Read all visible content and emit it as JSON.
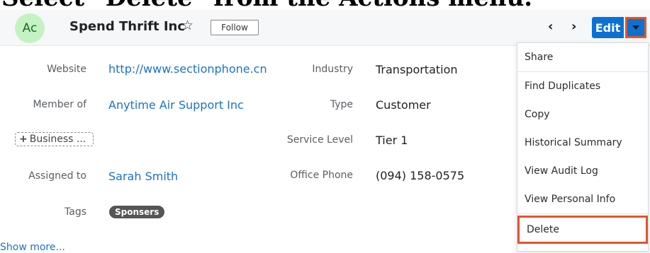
{
  "instruction": "Select \"Delete\" from the Actions menu.",
  "header": {
    "avatar_initials": "Ac",
    "record_name": "Spend Thrift Inc",
    "follow_label": "Follow",
    "edit_label": "Edit",
    "icons": [
      "star-icon",
      "chevron-left-icon",
      "chevron-right-icon",
      "caret-down-icon"
    ]
  },
  "fields": {
    "website": {
      "label": "Website",
      "value": "http://www.sectionphone.cn"
    },
    "member_of": {
      "label": "Member of",
      "value": "Anytime Air Support Inc"
    },
    "business_add": "Business ...",
    "assigned_to": {
      "label": "Assigned to",
      "value": "Sarah Smith"
    },
    "tags": {
      "label": "Tags",
      "value": "Sponsers"
    },
    "industry": {
      "label": "Industry",
      "value": "Transportation"
    },
    "type": {
      "label": "Type",
      "value": "Customer"
    },
    "service_level": {
      "label": "Service Level",
      "value": "Tier 1"
    },
    "office_phone": {
      "label": "Office Phone",
      "value": "(094) 158-0575"
    }
  },
  "show_more": "Show more...",
  "actions_menu": {
    "items": [
      {
        "label": "Share"
      },
      {
        "label": "Find Duplicates"
      },
      {
        "label": "Copy"
      },
      {
        "label": "Historical Summary"
      },
      {
        "label": "View Audit Log"
      },
      {
        "label": "View Personal Info"
      },
      {
        "label": "Delete"
      }
    ],
    "highlighted": "Delete"
  },
  "colors": {
    "accent": "#0a72d4",
    "highlight": "#e0552d",
    "link": "#1a73c7"
  }
}
